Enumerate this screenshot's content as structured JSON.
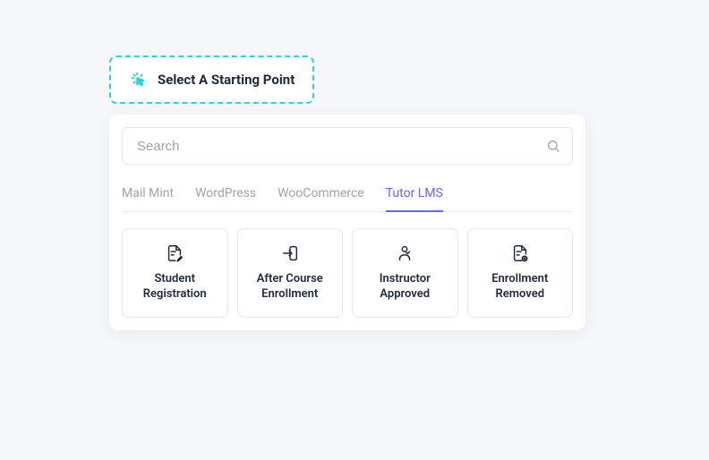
{
  "starting_point": {
    "label": "Select A Starting Point"
  },
  "search": {
    "placeholder": "Search"
  },
  "tabs": [
    {
      "label": "Mail Mint",
      "active": false
    },
    {
      "label": "WordPress",
      "active": false
    },
    {
      "label": "WooCommerce",
      "active": false
    },
    {
      "label": "Tutor LMS",
      "active": true
    }
  ],
  "options": [
    {
      "label": "Student\nRegistration",
      "icon": "document-icon"
    },
    {
      "label": "After Course\nEnrollment",
      "icon": "enter-icon"
    },
    {
      "label": "Instructor\nApproved",
      "icon": "person-icon"
    },
    {
      "label": "Enrollment\nRemoved",
      "icon": "document-remove-icon"
    }
  ]
}
